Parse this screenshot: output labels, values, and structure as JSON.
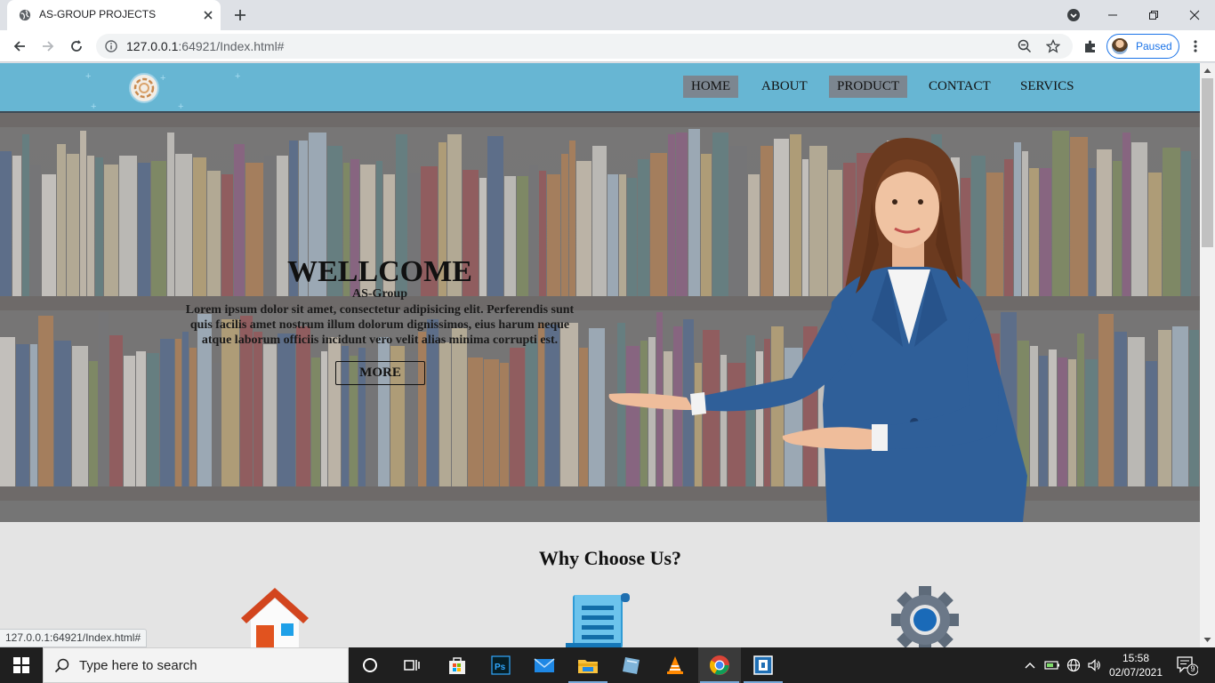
{
  "browser": {
    "tab_title": "AS-GROUP PROJECTS",
    "url_host": "127.0.0.1",
    "url_rest": ":64921/Index.html#",
    "profile_status": "Paused",
    "status_url": "127.0.0.1:64921/Index.html#"
  },
  "site": {
    "nav": [
      "HOME",
      "ABOUT",
      "PRODUCT",
      "CONTACT",
      "SERVICS"
    ],
    "hero": {
      "title": "WELLCOME",
      "subtitle": "AS-Group",
      "text": "Lorem ipsum dolor sit amet, consectetur adipisicing elit. Perferendis sunt quis facilis amet nostrum illum dolorum dignissimos, eius harum neque atque laborum officiis incidunt vero velit alias minima corrupti est.",
      "button": "MORE"
    },
    "why_title": "Why Choose Us?",
    "features": [
      "house-icon",
      "document-scroll-icon",
      "gear-icon"
    ]
  },
  "taskbar": {
    "search_placeholder": "Type here to search",
    "time": "15:58",
    "date": "02/07/2021",
    "notification_count": "9",
    "apps": [
      "task-view-icon",
      "store-icon",
      "photoshop-icon",
      "mail-icon",
      "file-explorer-icon",
      "notes-icon",
      "vlc-icon",
      "chrome-icon",
      "snip-tool-icon"
    ]
  },
  "colors": {
    "nav_bg": "#67b6d3",
    "nav_active": "#7c8690",
    "accent_blue": "#1a73e8"
  }
}
